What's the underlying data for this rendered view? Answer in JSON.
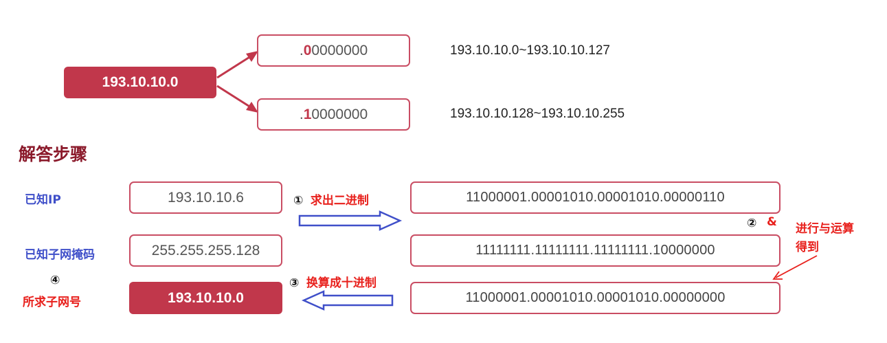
{
  "top": {
    "network": "193.10.10.0",
    "upper": {
      "prefix": ".",
      "highlight": "0",
      "rest": "0000000",
      "range": "193.10.10.0~193.10.10.127"
    },
    "lower": {
      "prefix": ".",
      "highlight": "1",
      "rest": "0000000",
      "range": "193.10.10.128~193.10.10.255"
    }
  },
  "steps": {
    "title": "解答步骤",
    "known_ip_label": "已知IP",
    "known_ip_value": "193.10.10.6",
    "known_mask_label": "已知子网掩码",
    "known_mask_value": "255.255.255.128",
    "result_marker": "④",
    "result_label": "所求子网号",
    "result_value": "193.10.10.0",
    "step1_marker": "①",
    "step1_text": "求出二进制",
    "step3_marker": "③",
    "step3_text": "换算成十进制",
    "step2_marker": "②",
    "step2_symbol": "&",
    "step2_text_line1": "进行与运算",
    "step2_text_line2": "得到",
    "ip_binary": "11000001.00001010.00001010.00000110",
    "mask_binary": "11111111.11111111.11111111.10000000",
    "result_binary": "11000001.00001010.00001010.00000000"
  },
  "colors": {
    "accent": "#c1374b",
    "border": "#c94d63",
    "blue": "#3f4fc9",
    "red": "#e8201c",
    "title": "#8b1a2b"
  }
}
